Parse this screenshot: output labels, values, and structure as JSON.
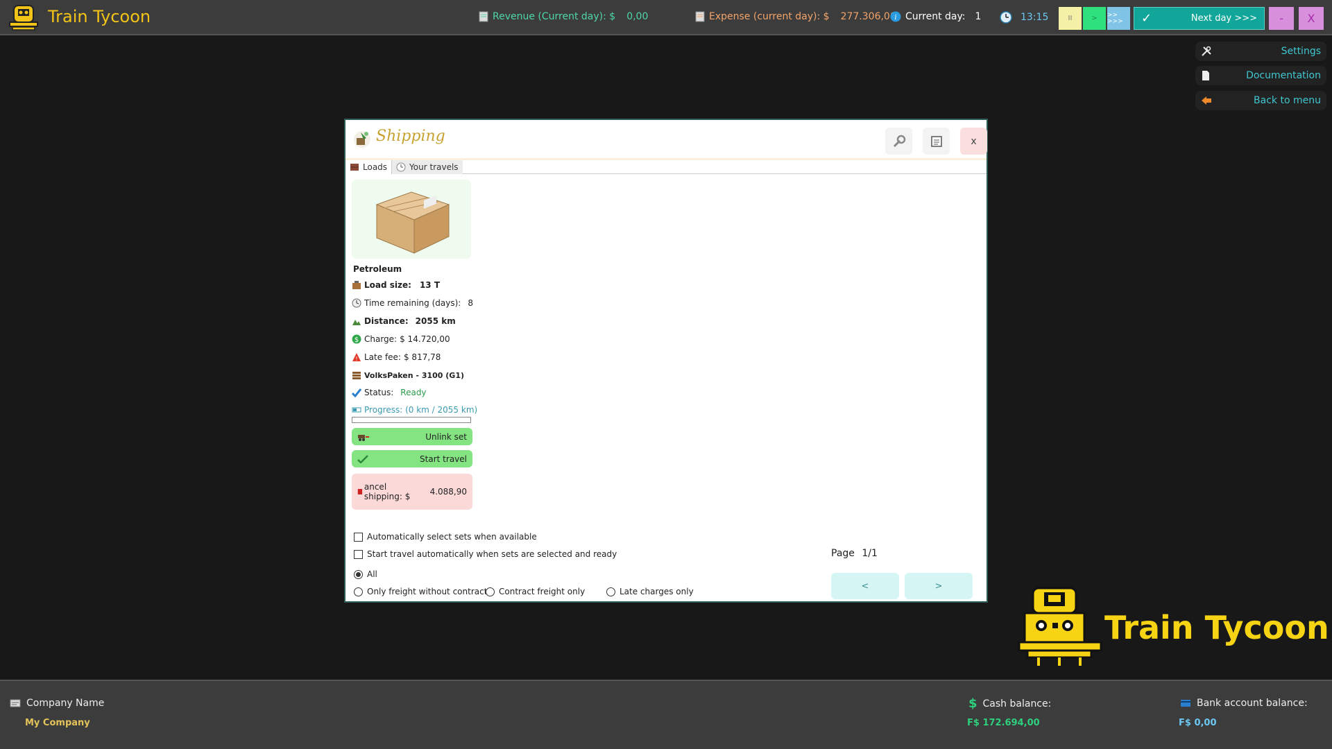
{
  "app": {
    "title": "Train Tycoon",
    "brand": "Train Tycoon"
  },
  "topbar": {
    "revenue_label": "Revenue (Current day): $",
    "revenue_value": "0,00",
    "expense_label": "Expense (current day): $",
    "expense_value": "277.306,00",
    "current_day_label": "Current day:",
    "current_day_value": "1",
    "time": "13:15",
    "pause_label": "II",
    "play_label": ">",
    "fast_label": ">> >>>",
    "next_day_label": "Next day >>>",
    "minimize_label": "-",
    "close_label": "X"
  },
  "side_menu": {
    "settings": "Settings",
    "documentation": "Documentation",
    "back": "Back to menu"
  },
  "dialog": {
    "title": "Shipping",
    "close_label": "x",
    "tabs": [
      {
        "label": "Loads"
      },
      {
        "label": "Your travels"
      }
    ],
    "card": {
      "name": "Petroleum",
      "load_size_label": "Load size:",
      "load_size_value": "13 T",
      "time_remaining_label": "Time remaining (days):",
      "time_remaining_value": "8",
      "distance_label": "Distance:",
      "distance_value": "2055 km",
      "charge_label": "Charge:",
      "charge_value": "$ 14.720,00",
      "late_fee_label": "Late fee:",
      "late_fee_value": "$ 817,78",
      "train_set": "VolksPaken - 3100 (G1)",
      "status_label": "Status:",
      "status_value": "Ready",
      "progress_label": "Progress: (0 km / 2055 km)",
      "progress_fraction": 0,
      "unlink_label": "Unlink set",
      "start_label": "Start travel",
      "cancel_label": "ancel shipping: $",
      "cancel_value": "4.088,90"
    },
    "options": {
      "auto_select": "Automatically select sets when available",
      "auto_start": "Start travel automatically when sets are selected and ready",
      "filter_all": "All",
      "filter_no_contract": "Only freight without contracts",
      "filter_contract": "Contract freight only",
      "filter_late": "Late charges only"
    },
    "pagination": {
      "label": "Page",
      "value": "1/1",
      "prev": "<",
      "next": ">"
    }
  },
  "bottombar": {
    "company_label": "Company Name",
    "company_value": "My Company",
    "cash_label": "Cash balance:",
    "cash_value": "F$  172.694,00",
    "bank_label": "Bank account balance:",
    "bank_value": "F$  0,00"
  },
  "colors": {
    "accent": "#f3c418",
    "revenue": "#4ed6a8",
    "expense": "#f2a46a",
    "next_day": "#12a59a",
    "side_text": "#3fc7d0",
    "cash": "#2ed07e",
    "bank": "#6cc7f2"
  }
}
